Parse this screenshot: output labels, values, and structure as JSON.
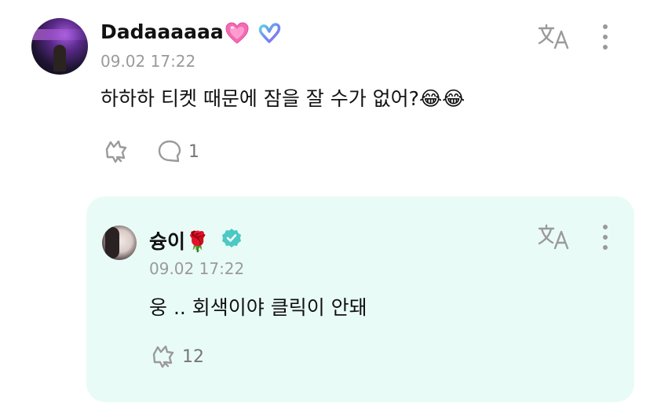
{
  "comment": {
    "username": "Dadaaaaaa",
    "timestamp": "09.02 17:22",
    "text": "하하하 티켓 때문에 잠을 잘 수가 없어?😂😂",
    "reply_count": "1",
    "badges": [
      "heart-badge",
      "weverse-membership-badge"
    ]
  },
  "reply": {
    "username": "슝이🌹",
    "timestamp": "09.02 17:22",
    "text": "웅 .. 회색이야 클릭이 안돼",
    "like_count": "12",
    "badges": [
      "verified-badge"
    ]
  },
  "colors": {
    "reply_background": "#e9fbf7",
    "timestamp": "#9a9a9a",
    "icon_gray": "#9a9a9a",
    "verified": "#4cc9c4"
  },
  "icons": [
    "translate-icon",
    "more-icon",
    "like-icon",
    "reply-icon"
  ]
}
